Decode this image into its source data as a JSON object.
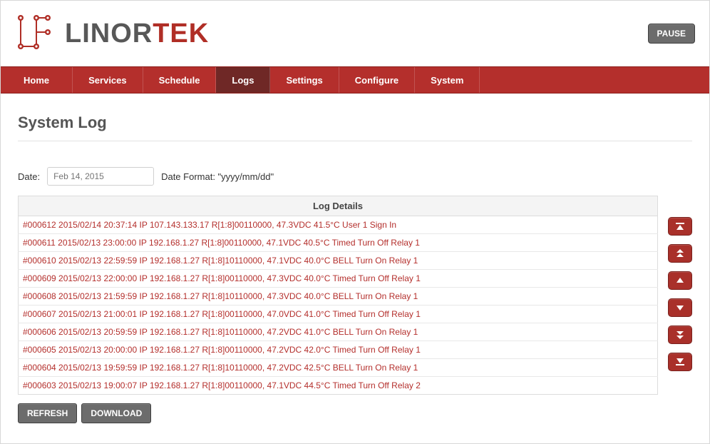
{
  "brand": {
    "first": "LINOR",
    "accent": "TEK"
  },
  "pause_label": "PAUSE",
  "nav": {
    "items": [
      {
        "label": "Home"
      },
      {
        "label": "Services"
      },
      {
        "label": "Schedule"
      },
      {
        "label": "Logs",
        "active": true
      },
      {
        "label": "Settings"
      },
      {
        "label": "Configure"
      },
      {
        "label": "System"
      }
    ]
  },
  "page_title": "System Log",
  "date_label": "Date:",
  "date_placeholder": "Feb 14, 2015",
  "date_format_label": "Date Format: \"yyyy/mm/dd\"",
  "log_header": "Log Details",
  "logs": [
    "#000612 2015/02/14 20:37:14 IP 107.143.133.17 R[1:8]00110000, 47.3VDC 41.5°C User 1 Sign In",
    "#000611 2015/02/13 23:00:00 IP 192.168.1.27 R[1:8]00110000, 47.1VDC 40.5°C Timed Turn Off Relay 1",
    "#000610 2015/02/13 22:59:59 IP 192.168.1.27 R[1:8]10110000, 47.1VDC 40.0°C BELL Turn On Relay 1",
    "#000609 2015/02/13 22:00:00 IP 192.168.1.27 R[1:8]00110000, 47.3VDC 40.0°C Timed Turn Off Relay 1",
    "#000608 2015/02/13 21:59:59 IP 192.168.1.27 R[1:8]10110000, 47.3VDC 40.0°C BELL Turn On Relay 1",
    "#000607 2015/02/13 21:00:01 IP 192.168.1.27 R[1:8]00110000, 47.0VDC 41.0°C Timed Turn Off Relay 1",
    "#000606 2015/02/13 20:59:59 IP 192.168.1.27 R[1:8]10110000, 47.2VDC 41.0°C BELL Turn On Relay 1",
    "#000605 2015/02/13 20:00:00 IP 192.168.1.27 R[1:8]00110000, 47.2VDC 42.0°C Timed Turn Off Relay 1",
    "#000604 2015/02/13 19:59:59 IP 192.168.1.27 R[1:8]10110000, 47.2VDC 42.5°C BELL Turn On Relay 1",
    "#000603 2015/02/13 19:00:07 IP 192.168.1.27 R[1:8]00110000, 47.1VDC 44.5°C Timed Turn Off Relay 2"
  ],
  "actions": {
    "refresh": "REFRESH",
    "download": "DOWNLOAD"
  }
}
